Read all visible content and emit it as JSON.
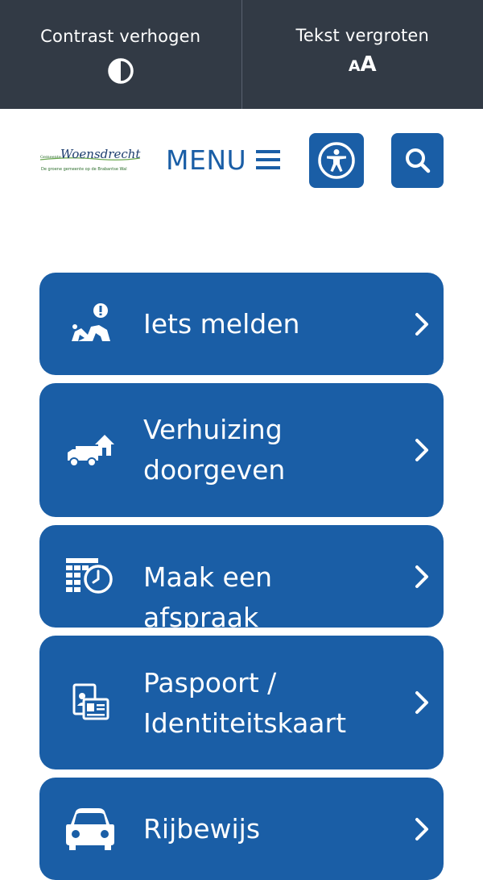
{
  "topbar": {
    "contrast_label": "Contrast verhogen",
    "textsize_label": "Tekst vergroten",
    "textsize_small": "A",
    "textsize_large": "A",
    "background_color": "#323a45"
  },
  "header": {
    "logo": {
      "prefix": "Gemeente",
      "name": "Woensdrecht",
      "tagline": "De groene gemeente op de Brabantse Wal"
    },
    "menu_label": "MENU",
    "accent_color": "#1a5ea6"
  },
  "tiles": [
    {
      "label": "Iets melden",
      "icon": "report-icon"
    },
    {
      "label": "Verhuizing doorgeven",
      "icon": "moving-truck-icon"
    },
    {
      "label": "Maak een afspraak",
      "icon": "calendar-clock-icon"
    },
    {
      "label": "Paspoort / Identiteitskaart",
      "icon": "id-card-icon"
    },
    {
      "label": "Rijbewijs",
      "icon": "car-icon"
    }
  ]
}
